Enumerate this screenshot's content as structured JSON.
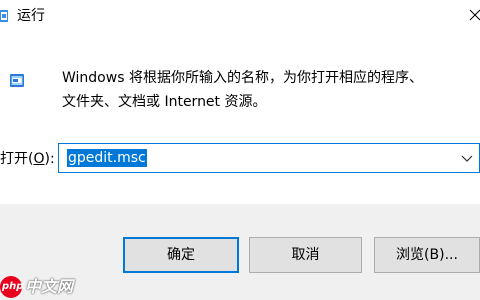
{
  "window": {
    "title": "运行"
  },
  "description": {
    "line1": "Windows 将根据你所输入的名称，为你打开相应的程序、",
    "line2": "文件夹、文档或 Internet 资源。"
  },
  "open": {
    "label_prefix": "打开(",
    "label_hotkey": "O",
    "label_suffix": "):",
    "value": "gpedit.msc"
  },
  "buttons": {
    "ok": "确定",
    "cancel": "取消",
    "browse": "浏览(B)..."
  },
  "watermark": {
    "logo": "php",
    "text": "中文网"
  },
  "colors": {
    "accent": "#0078d7",
    "footer_bg": "#f0f0f0",
    "button_bg": "#e1e1e1",
    "watermark_red": "#e8001c"
  },
  "icons": {
    "app": "run-app-icon",
    "run": "run-icon",
    "close": "close-icon",
    "dropdown": "chevron-down-icon"
  }
}
